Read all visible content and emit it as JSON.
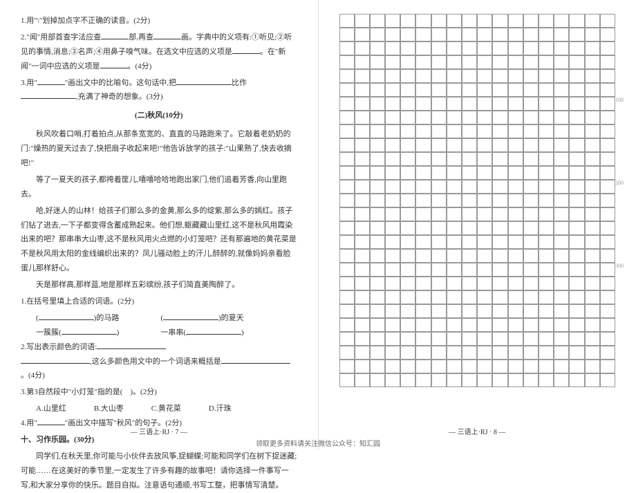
{
  "left": {
    "q1": "1.用\"\\\"划掉加点字不正确的读音。(2分)",
    "q2_a": "2.\"闻\"用部首查字法应查",
    "q2_b": "部,再查",
    "q2_c": "画。字典中的义项有:①听见;②听见的事情,消息;③名声;④用鼻子嗅气味。在选文中应选的义项是",
    "q2_d": "。在\"新闻\"一词中应选的义项是",
    "q2_e": "。(4分)",
    "q3_a": "3.用\"",
    "q3_b": "\"画出文中的比喻句。这句话中,把",
    "q3_c": "比作",
    "q3_d": ",充满了神奇的想象。(3分)",
    "section2_title": "(二)秋风(10分)",
    "p1": "秋风吹着口哨,打着拍点,从那条宽宽的、直直的马路跑来了。它敲着老奶奶的门:\"燥热的夏天过去了,快把扇子收起来吧!\"他告诉放学的孩子:\"山果熟了,快去收摘吧!\"",
    "p2": "等了一夏天的孩子,都挎着筐儿,嘻嘻哈哈地跑出家门,他们追着芳香,向山里跑去。",
    "p3": "哈,好迷人的山林！给孩子们那么多的金黄,那么多的绽紫,那么多的嫣红。孩子们钻了进去,一下子都变得含蓄成熟起来。他们想,躯藏藏山里红,这不是秋风用霞染出来的吧？那串串大山枣,这不是秋风用火点燃的小灯笼吧？还有那遍地的黄花菜是不是秋风用太阳的金线编织出来的？凤儿骚动脸上的汗儿,醉醉的,就像妈妈亲看脸蛋儿那样舒心。",
    "p4": "天是那样高,那样蓝,地是那样五彩缤纷,孩子们简直美陶醉了。",
    "sq1": "1.在括号里填上合适的词语。(2分)",
    "sq1_opt1_a": "(",
    "sq1_opt1_b": ")的马路",
    "sq1_opt2_a": "(",
    "sq1_opt2_b": ")的夏天",
    "sq1_opt3": "一簇簇(",
    "sq1_opt3b": ")",
    "sq1_opt4": "一串串(",
    "sq1_opt4b": ")",
    "sq2_a": "2.写出表示颜色的词语:",
    "sq2_b": ",这么多颜色用文中的一个词语来概括是",
    "sq2_c": "。(4分)",
    "sq3": "3.第3自然段中\"小灯笼\"指的是(　)。(2分)",
    "sq3_a": "A.山里红",
    "sq3_b": "B.大山枣",
    "sq3_c": "C.黄花菜",
    "sq3_d": "D.汗珠",
    "sq4_a": "4.用\"",
    "sq4_b": "\"画出文中描写\"秋风\"的句子。(2分)",
    "q10_title": "十、习作乐园。(30分)",
    "q10_body": "同学们,在秋天里,你可能与小伙伴去放风筝,捉蝴蝶;可能和同学们在树下捉迷藏;可能……在这美好的季节里,一定发生了许多有趣的故事吧！请你选择一件事写一写,和大家分享你的快乐。题目自拟。注意语句通顺,书写工整，把事情写清楚。",
    "footer": "— 三语上·RJ · 7 —"
  },
  "right": {
    "footer": "— 三语上·RJ · 8 —",
    "marker100": "100",
    "marker200": "200",
    "marker300": "300"
  },
  "bottom": "领取更多资料请关注微信公众号：知汇园"
}
